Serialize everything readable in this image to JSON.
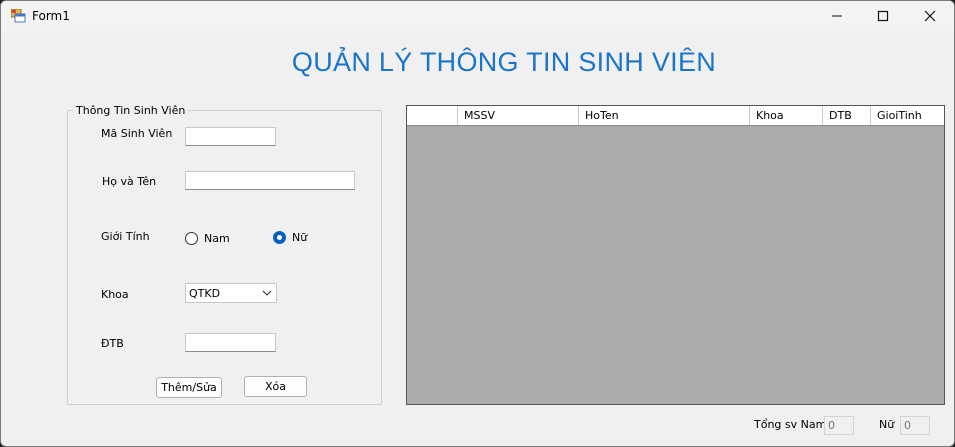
{
  "window": {
    "title": "Form1"
  },
  "heading": "QUẢN LÝ THÔNG TIN SINH VIÊN",
  "group": {
    "legend": "Thông Tin Sinh Viên",
    "mssv_label": "Mã Sinh Viên",
    "mssv_value": "",
    "name_label": "Họ và Tên",
    "name_value": "",
    "gender_label": "Giới Tính",
    "male_label": "Nam",
    "female_label": "Nữ",
    "selected_gender": "Nữ",
    "faculty_label": "Khoa",
    "faculty_value": "QTKD",
    "gpa_label": "ĐTB",
    "gpa_value": ""
  },
  "buttons": {
    "add_edit": "Thêm/Sửa",
    "delete": "Xóa"
  },
  "grid": {
    "columns": [
      "",
      "MSSV",
      "HoTen",
      "Khoa",
      "DTB",
      "GioiTinh"
    ],
    "rows": []
  },
  "summary": {
    "male_label": "Tổng sv Nam",
    "male_count": "0",
    "female_label": "Nữ",
    "female_count": "0"
  },
  "colors": {
    "heading": "#1b75c9",
    "radio_checked": "#0a60c2",
    "grid_bg": "#ababab"
  }
}
